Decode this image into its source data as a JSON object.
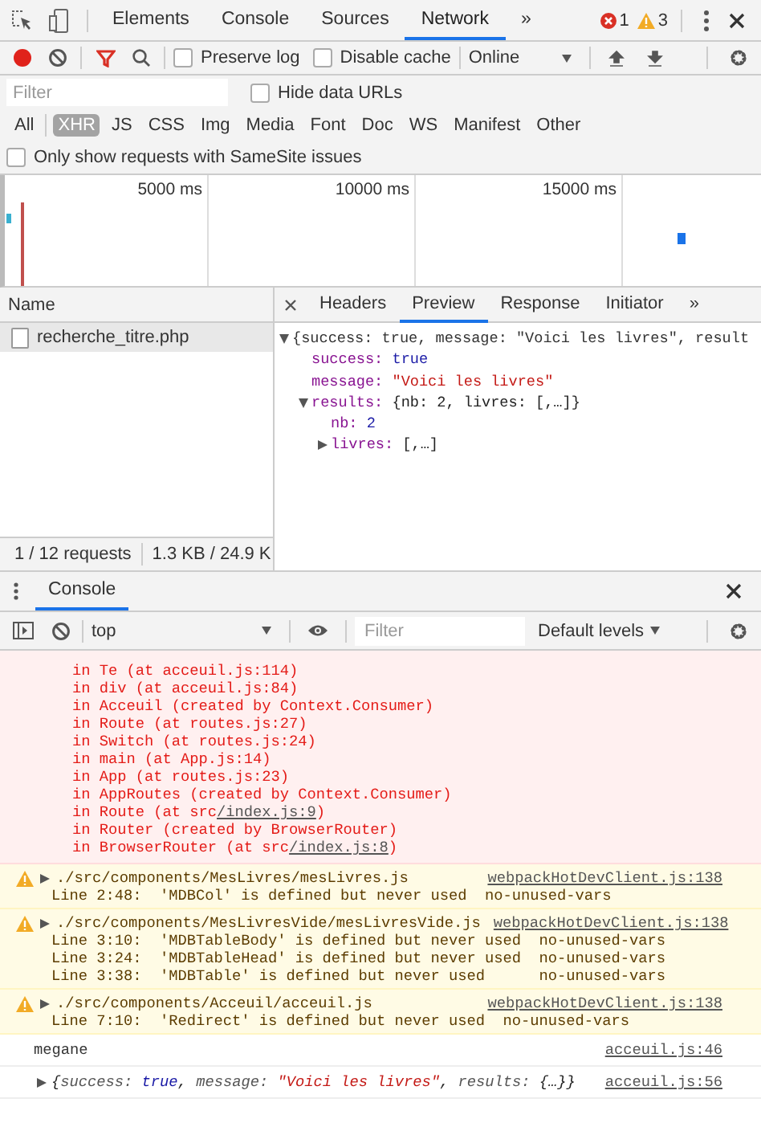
{
  "tab_bar": {
    "tabs": [
      {
        "label": "Elements",
        "selected": false
      },
      {
        "label": "Console",
        "selected": false
      },
      {
        "label": "Sources",
        "selected": false
      },
      {
        "label": "Network",
        "selected": true
      }
    ],
    "more": "»",
    "errors": "1",
    "warnings": "3"
  },
  "network_toolbar": {
    "recording": true,
    "preserve_log": {
      "label": "Preserve log",
      "checked": false
    },
    "disable_cache": {
      "label": "Disable cache",
      "checked": false
    },
    "throttling": "Online"
  },
  "filter_bar": {
    "placeholder": "Filter",
    "hide_data_urls": {
      "label": "Hide data URLs",
      "checked": false
    }
  },
  "type_filters": [
    {
      "label": "All",
      "selected": false
    },
    {
      "label": "XHR",
      "selected": true
    },
    {
      "label": "JS",
      "selected": false
    },
    {
      "label": "CSS",
      "selected": false
    },
    {
      "label": "Img",
      "selected": false
    },
    {
      "label": "Media",
      "selected": false
    },
    {
      "label": "Font",
      "selected": false
    },
    {
      "label": "Doc",
      "selected": false
    },
    {
      "label": "WS",
      "selected": false
    },
    {
      "label": "Manifest",
      "selected": false
    },
    {
      "label": "Other",
      "selected": false
    }
  ],
  "samesite_filter": {
    "label": "Only show requests with SameSite issues",
    "checked": false
  },
  "timeline": {
    "ticks": [
      "5000 ms",
      "10000 ms",
      "15000 ms"
    ]
  },
  "requests": {
    "column": "Name",
    "rows": [
      {
        "name": "recherche_titre.php",
        "selected": true
      }
    ]
  },
  "status_bar": [
    "1 / 12 requests",
    "1.3 KB / 24.9 K"
  ],
  "detail": {
    "tabs": [
      {
        "label": "Headers",
        "selected": false
      },
      {
        "label": "Preview",
        "selected": true
      },
      {
        "label": "Response",
        "selected": false
      },
      {
        "label": "Initiator",
        "selected": false
      }
    ],
    "more": "»",
    "preview": {
      "summary": "{success: true, message: \"Voici les livres\", result",
      "expanded": true,
      "children": [
        {
          "key": "success:",
          "value": "true",
          "kind": "boolean"
        },
        {
          "key": "message:",
          "value": "\"Voici les livres\"",
          "kind": "string"
        },
        {
          "key": "results:",
          "value": "{nb: 2, livres: [,…]}",
          "kind": "object",
          "expanded": true,
          "children": [
            {
              "key": "nb:",
              "value": "2",
              "kind": "number"
            },
            {
              "key": "livres:",
              "value": "[,…]",
              "kind": "object",
              "expanded": false
            }
          ]
        }
      ]
    }
  },
  "drawer": {
    "tabs": [
      {
        "label": "Console",
        "selected": true
      }
    ],
    "context": "top",
    "filter_placeholder": "Filter",
    "levels": "Default levels",
    "messages": [
      {
        "kind": "error",
        "lines": [
          [
            {
              "text": "in Te (at acceuil.js:114)",
              "link": false
            }
          ],
          [
            {
              "text": "in div (at acceuil.js:84)",
              "link": false
            }
          ],
          [
            {
              "text": "in Acceuil (created by Context.Consumer)",
              "link": false
            }
          ],
          [
            {
              "text": "in Route (at routes.js:27)",
              "link": false
            }
          ],
          [
            {
              "text": "in Switch (at routes.js:24)",
              "link": false
            }
          ],
          [
            {
              "text": "in main (at App.js:14)",
              "link": false
            }
          ],
          [
            {
              "text": "in App (at routes.js:23)",
              "link": false
            }
          ],
          [
            {
              "text": "in AppRoutes (created by Context.Consumer)",
              "link": false
            }
          ],
          [
            {
              "text": "in Route (at src",
              "link": false
            },
            {
              "text": "/index.js:9",
              "link": true
            },
            {
              "text": ")",
              "link": false
            }
          ],
          [
            {
              "text": "in Router (created by BrowserRouter)",
              "link": false
            }
          ],
          [
            {
              "text": "in BrowserRouter (at src",
              "link": false
            },
            {
              "text": "/index.js:8",
              "link": true
            },
            {
              "text": ")",
              "link": false
            }
          ]
        ]
      },
      {
        "kind": "warning",
        "expanded": false,
        "source": "./src/components/MesLivres/mesLivres.js",
        "link": "webpackHotDevClient.js:138",
        "lines": [
          "Line 2:48:  'MDBCol' is defined but never used  no-unused-vars"
        ]
      },
      {
        "kind": "warning",
        "expanded": false,
        "source": "./src/components/MesLivresVide/mesLivresVide.js",
        "link": "webpackHotDevClient.js:138",
        "lines": [
          "Line 3:10:  'MDBTableBody' is defined but never used  no-unused-vars",
          "Line 3:24:  'MDBTableHead' is defined but never used  no-unused-vars",
          "Line 3:38:  'MDBTable' is defined but never used      no-unused-vars"
        ]
      },
      {
        "kind": "warning",
        "expanded": false,
        "source": "./src/components/Acceuil/acceuil.js",
        "link": "webpackHotDevClient.js:138",
        "lines": [
          "Line 7:10:  'Redirect' is defined but never used  no-unused-vars"
        ]
      },
      {
        "kind": "log",
        "text": "megane",
        "link": "acceuil.js:46"
      },
      {
        "kind": "object",
        "expanded": false,
        "link": "acceuil.js:56",
        "segments": [
          {
            "text": "{",
            "kind": "plain"
          },
          {
            "text": "success: ",
            "kind": "key"
          },
          {
            "text": "true",
            "kind": "boolean"
          },
          {
            "text": ", ",
            "kind": "plain"
          },
          {
            "text": "message: ",
            "kind": "key"
          },
          {
            "text": "\"Voici les livres\"",
            "kind": "string"
          },
          {
            "text": ", ",
            "kind": "plain"
          },
          {
            "text": "results: ",
            "kind": "key"
          },
          {
            "text": "{…}}",
            "kind": "plain"
          }
        ]
      }
    ]
  }
}
